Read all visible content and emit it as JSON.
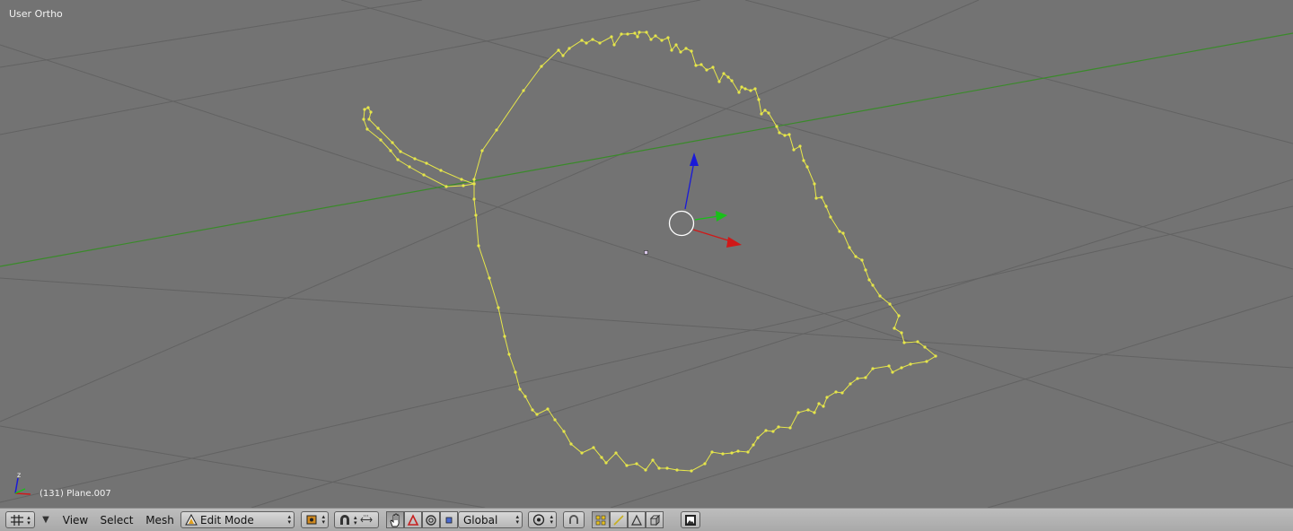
{
  "viewport": {
    "view_name": "User Ortho",
    "object_info": "(131) Plane.007",
    "mini_axis_label": "z",
    "background": "#737373",
    "mesh_color": "#e6e64a",
    "axis_x_color": "#d01818",
    "axis_y_color": "#18c018",
    "axis_z_color": "#1a1ad8"
  },
  "header": {
    "menus": {
      "view": "View",
      "select": "Select",
      "mesh": "Mesh"
    },
    "mode": "Edit Mode",
    "orientation": "Global",
    "icons": [
      "grid-editor-icon",
      "dropdown-arrow-icon",
      "mode-icon",
      "pivot-icon",
      "magnet-icon",
      "transform-manipulator-icon",
      "hand-icon",
      "triangle-icon",
      "ring-icon",
      "square-icon",
      "proportional-icon",
      "snap-icon",
      "vertex-select-icon",
      "edge-select-icon",
      "face-select-icon",
      "limit-selection-icon",
      "render-icon"
    ]
  }
}
